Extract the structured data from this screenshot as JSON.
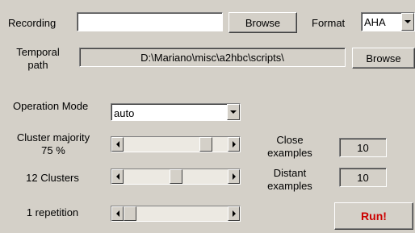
{
  "recording": {
    "label": "Recording",
    "value": "",
    "browse_label": "Browse"
  },
  "format": {
    "label": "Format",
    "value": "AHA"
  },
  "temporal_path": {
    "label": "Temporal path",
    "value": "D:\\Mariano\\misc\\a2hbc\\scripts\\",
    "browse_label": "Browse"
  },
  "operation_mode": {
    "label": "Operation Mode",
    "value": "auto"
  },
  "cluster_majority": {
    "label": "Cluster majority",
    "value_text": "75 %",
    "slider_fraction": 0.83
  },
  "clusters": {
    "label": "12 Clusters",
    "slider_fraction": 0.5
  },
  "repetitions": {
    "label": "1 repetition",
    "slider_fraction": 0.0
  },
  "close_examples": {
    "label": "Close examples",
    "value": "10"
  },
  "distant_examples": {
    "label": "Distant examples",
    "value": "10"
  },
  "run_button": {
    "label": "Run!",
    "color": "#cc0000"
  }
}
